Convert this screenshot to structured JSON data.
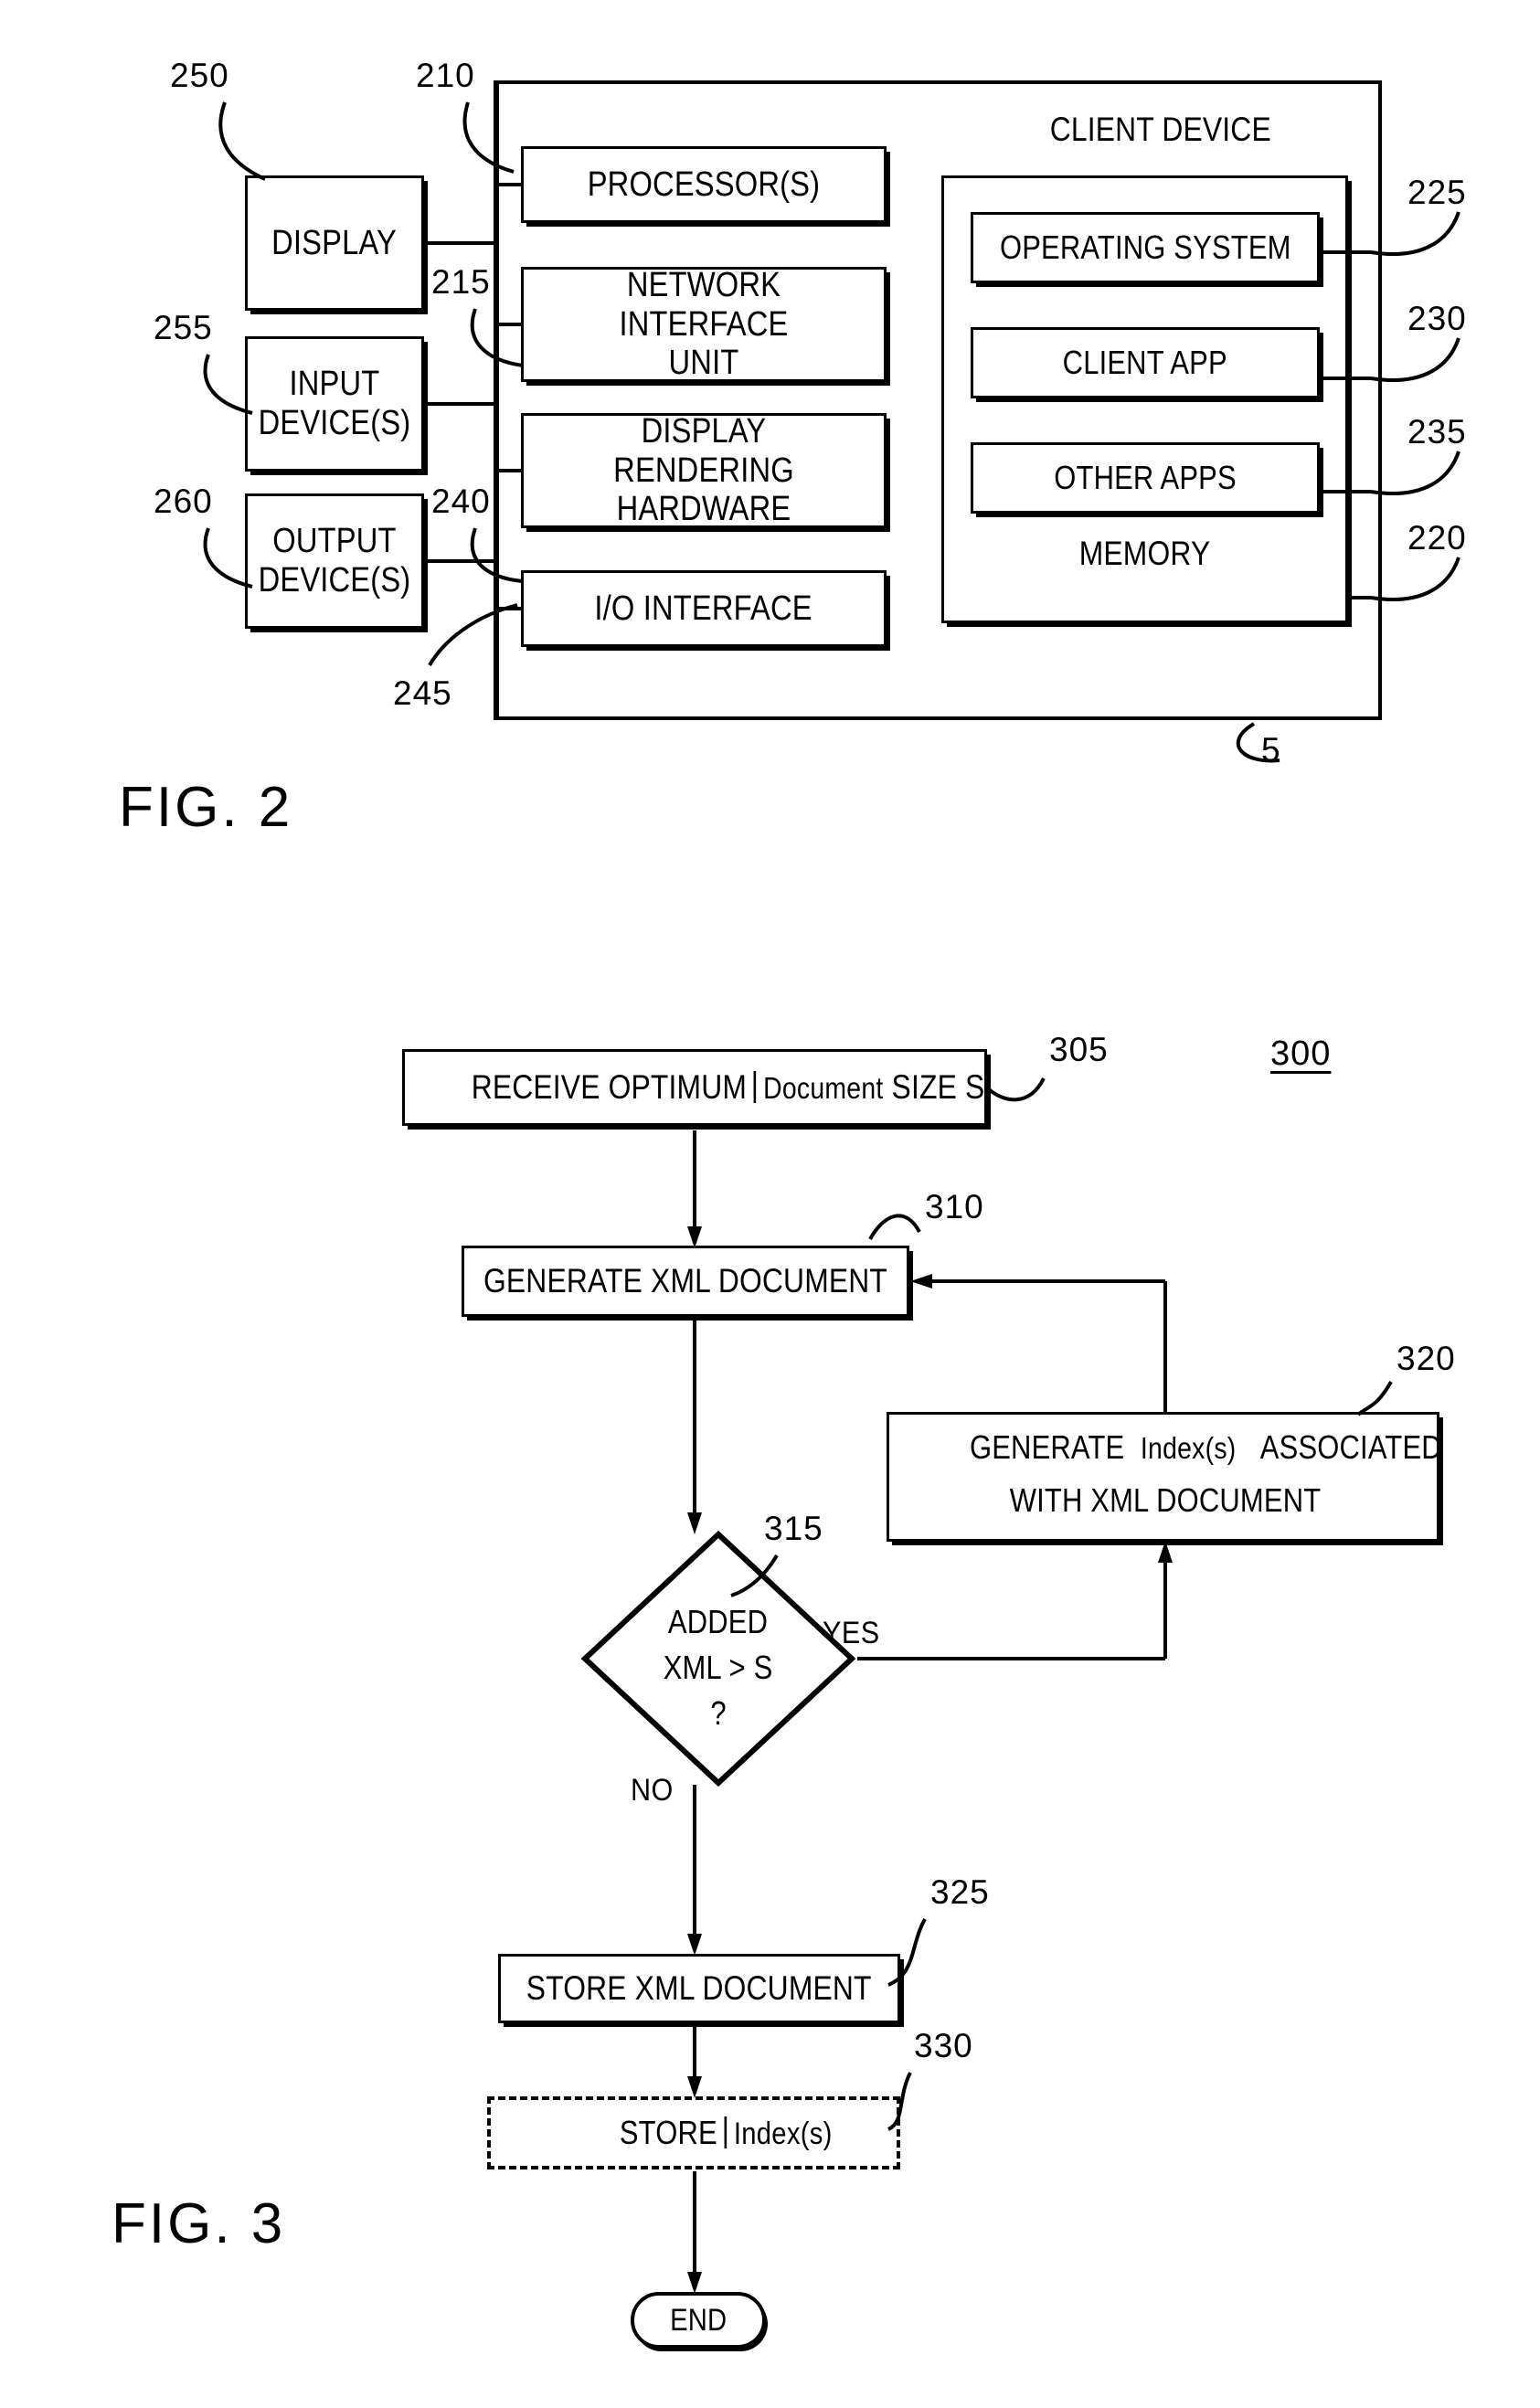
{
  "figures": [
    {
      "id": "fig2",
      "label": "FIG. 2",
      "title": "CLIENT DEVICE",
      "system_ref": "5",
      "peripherals": [
        {
          "ref": "250",
          "label": "DISPLAY"
        },
        {
          "ref": "255",
          "label": "INPUT\nDEVICE(S)"
        },
        {
          "ref": "260",
          "label": "OUTPUT\nDEVICE(S)"
        }
      ],
      "internals": [
        {
          "ref": "210",
          "label": "PROCESSOR(S)"
        },
        {
          "ref": "215",
          "label": "NETWORK INTERFACE\nUNIT"
        },
        {
          "ref": "240",
          "label": "DISPLAY RENDERING\nHARDWARE"
        },
        {
          "ref": "245",
          "label": "I/O INTERFACE"
        }
      ],
      "memory": {
        "ref": "220",
        "label": "MEMORY",
        "items": [
          {
            "ref": "225",
            "label": "OPERATING SYSTEM"
          },
          {
            "ref": "230",
            "label": "CLIENT APP"
          },
          {
            "ref": "235",
            "label": "OTHER APPS"
          }
        ]
      }
    },
    {
      "id": "fig3",
      "label": "FIG. 3",
      "process_ref": "300",
      "steps": [
        {
          "ref": "305",
          "kind": "process",
          "text_parts": [
            "RECEIVE OPTIMUM",
            "Document",
            "SIZE S"
          ]
        },
        {
          "ref": "310",
          "kind": "process",
          "text": "GENERATE XML DOCUMENT"
        },
        {
          "ref": "315",
          "kind": "decision",
          "line1": "ADDED",
          "line2": "XML > S",
          "line3": "?",
          "yes_label": "YES",
          "no_label": "NO"
        },
        {
          "ref": "320",
          "kind": "process",
          "text_parts": [
            "GENERATE",
            "Index(s)",
            "ASSOCIATED"
          ],
          "line2": "WITH XML DOCUMENT"
        },
        {
          "ref": "325",
          "kind": "process",
          "text": "STORE XML DOCUMENT"
        },
        {
          "ref": "330",
          "kind": "process-optional",
          "text_parts": [
            "STORE",
            "Index(s)"
          ]
        },
        {
          "ref": "end",
          "kind": "terminal",
          "text": "END"
        }
      ]
    }
  ],
  "colors": {
    "ink": "#000000",
    "paper": "#ffffff"
  }
}
